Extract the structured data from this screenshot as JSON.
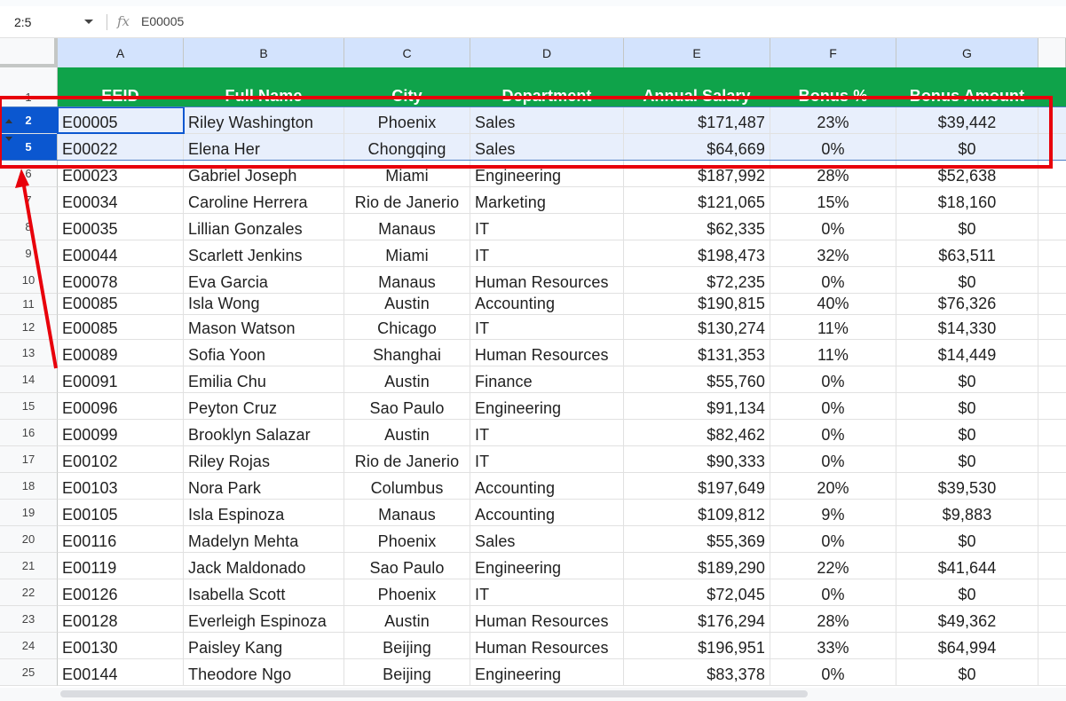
{
  "formula_bar": {
    "name_box": "2:5",
    "fx_label": "fx",
    "formula": "E00005"
  },
  "columns": [
    "A",
    "B",
    "C",
    "D",
    "E",
    "F",
    "G"
  ],
  "header_row": {
    "row_number": "1",
    "cells": [
      "EEID",
      "Full Name",
      "City",
      "Department",
      "Annual Salary",
      "Bonus %",
      "Bonus Amount"
    ]
  },
  "rows": [
    {
      "num": "2",
      "cells": [
        "E00005",
        "Riley Washington",
        "Phoenix",
        "Sales",
        "$171,487",
        "23%",
        "$39,442"
      ]
    },
    {
      "num": "5",
      "cells": [
        "E00022",
        "Elena Her",
        "Chongqing",
        "Sales",
        "$64,669",
        "0%",
        "$0"
      ]
    },
    {
      "num": "6",
      "cells": [
        "E00023",
        "Gabriel Joseph",
        "Miami",
        "Engineering",
        "$187,992",
        "28%",
        "$52,638"
      ]
    },
    {
      "num": "7",
      "cells": [
        "E00034",
        "Caroline Herrera",
        "Rio de Janerio",
        "Marketing",
        "$121,065",
        "15%",
        "$18,160"
      ]
    },
    {
      "num": "8",
      "cells": [
        "E00035",
        "Lillian Gonzales",
        "Manaus",
        "IT",
        "$62,335",
        "0%",
        "$0"
      ]
    },
    {
      "num": "9",
      "cells": [
        "E00044",
        "Scarlett Jenkins",
        "Miami",
        "IT",
        "$198,473",
        "32%",
        "$63,511"
      ]
    },
    {
      "num": "10",
      "cells": [
        "E00078",
        "Eva Garcia",
        "Manaus",
        "Human Resources",
        "$72,235",
        "0%",
        "$0"
      ]
    },
    {
      "num": "11",
      "cells": [
        "E00085",
        "Isla Wong",
        "Austin",
        "Accounting",
        "$190,815",
        "40%",
        "$76,326"
      ]
    },
    {
      "num": "12",
      "cells": [
        "E00085",
        "Mason Watson",
        "Chicago",
        "IT",
        "$130,274",
        "11%",
        "$14,330"
      ]
    },
    {
      "num": "13",
      "cells": [
        "E00089",
        "Sofia Yoon",
        "Shanghai",
        "Human Resources",
        "$131,353",
        "11%",
        "$14,449"
      ]
    },
    {
      "num": "14",
      "cells": [
        "E00091",
        "Emilia Chu",
        "Austin",
        "Finance",
        "$55,760",
        "0%",
        "$0"
      ]
    },
    {
      "num": "15",
      "cells": [
        "E00096",
        "Peyton Cruz",
        "Sao Paulo",
        "Engineering",
        "$91,134",
        "0%",
        "$0"
      ]
    },
    {
      "num": "16",
      "cells": [
        "E00099",
        "Brooklyn Salazar",
        "Austin",
        "IT",
        "$82,462",
        "0%",
        "$0"
      ]
    },
    {
      "num": "17",
      "cells": [
        "E00102",
        "Riley Rojas",
        "Rio de Janerio",
        "IT",
        "$90,333",
        "0%",
        "$0"
      ]
    },
    {
      "num": "18",
      "cells": [
        "E00103",
        "Nora Park",
        "Columbus",
        "Accounting",
        "$197,649",
        "20%",
        "$39,530"
      ]
    },
    {
      "num": "19",
      "cells": [
        "E00105",
        "Isla Espinoza",
        "Manaus",
        "Accounting",
        "$109,812",
        "9%",
        "$9,883"
      ]
    },
    {
      "num": "20",
      "cells": [
        "E00116",
        "Madelyn Mehta",
        "Phoenix",
        "Sales",
        "$55,369",
        "0%",
        "$0"
      ]
    },
    {
      "num": "21",
      "cells": [
        "E00119",
        "Jack Maldonado",
        "Sao Paulo",
        "Engineering",
        "$189,290",
        "22%",
        "$41,644"
      ]
    },
    {
      "num": "22",
      "cells": [
        "E00126",
        "Isabella Scott",
        "Phoenix",
        "IT",
        "$72,045",
        "0%",
        "$0"
      ]
    },
    {
      "num": "23",
      "cells": [
        "E00128",
        "Everleigh Espinoza",
        "Austin",
        "Human Resources",
        "$176,294",
        "28%",
        "$49,362"
      ]
    },
    {
      "num": "24",
      "cells": [
        "E00130",
        "Paisley Kang",
        "Beijing",
        "Human Resources",
        "$196,951",
        "33%",
        "$64,994"
      ]
    },
    {
      "num": "25",
      "cells": [
        "E00144",
        "Theodore Ngo",
        "Beijing",
        "Engineering",
        "$83,378",
        "0%",
        "$0"
      ]
    }
  ],
  "selected_rows": [
    "2",
    "5"
  ],
  "colors": {
    "header_green": "#0fa34a",
    "selection_blue": "#0b57d0",
    "annotation_red": "#e8000b"
  }
}
